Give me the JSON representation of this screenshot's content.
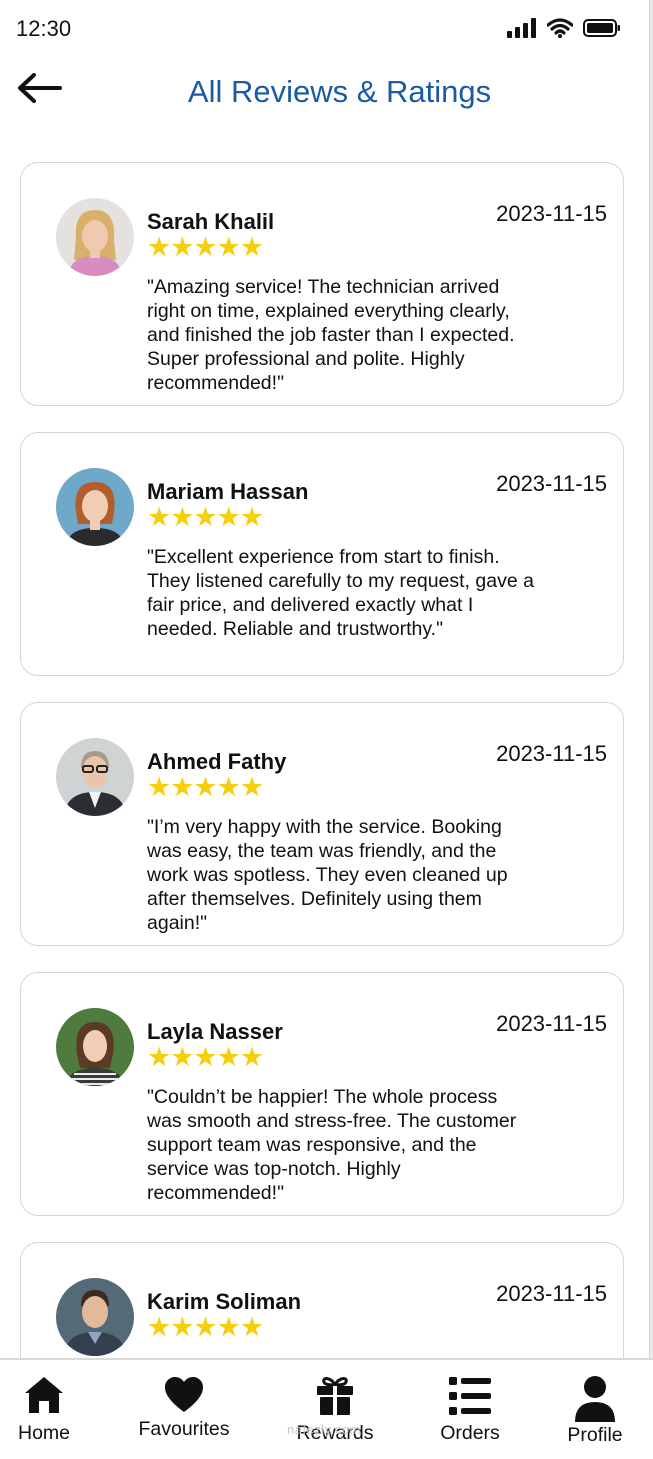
{
  "status_bar": {
    "time": "12:30"
  },
  "header": {
    "title": "All Reviews & Ratings"
  },
  "reviews": [
    {
      "name": "Sarah Khalil",
      "date": "2023-11-15",
      "stars": "★★★★★",
      "rating": 5,
      "text": "\"Amazing service! The technician arrived right on time, explained everything clearly, and finished the job faster than I expected. Super professional and polite. Highly recommended!\""
    },
    {
      "name": "Mariam Hassan",
      "date": "2023-11-15",
      "stars": "★★★★★",
      "rating": 5,
      "text": "\"Excellent experience from start to finish. They listened carefully to my request, gave a fair price, and delivered exactly what I needed. Reliable and trustworthy.\""
    },
    {
      "name": "Ahmed Fathy",
      "date": "2023-11-15",
      "stars": "★★★★★",
      "rating": 5,
      "text": "\"I’m very happy with the service. Booking was easy, the team was friendly, and the work was spotless. They even cleaned up after themselves. Definitely using them again!\""
    },
    {
      "name": "Layla Nasser",
      "date": "2023-11-15",
      "stars": "★★★★★",
      "rating": 5,
      "text": "\"Couldn’t be happier! The whole process was smooth and stress-free. The customer support team was responsive, and the service was top-notch. Highly recommended!\""
    },
    {
      "name": "Karim Soliman",
      "date": "2023-11-15",
      "stars": "★★★★★",
      "rating": 5,
      "text": ""
    }
  ],
  "bottom_nav": [
    {
      "label": "Home",
      "icon": "home-icon"
    },
    {
      "label": "Favourites",
      "icon": "heart-icon"
    },
    {
      "label": "Rewards",
      "icon": "gift-icon"
    },
    {
      "label": "Orders",
      "icon": "list-icon"
    },
    {
      "label": "Profile",
      "icon": "user-icon"
    }
  ],
  "watermark": "nafezly.com",
  "colors": {
    "title": "#1a5aa6",
    "star": "#f5cf0b",
    "card_border": "#d6d6d6"
  }
}
